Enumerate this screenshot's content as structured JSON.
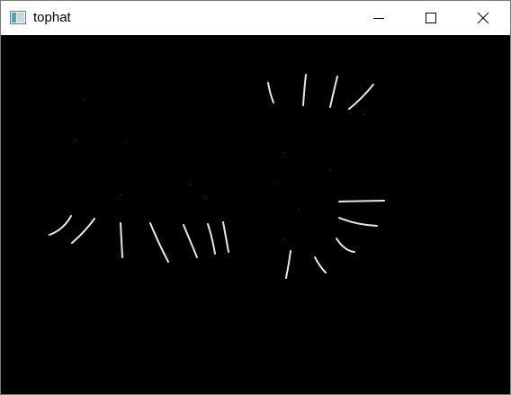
{
  "window": {
    "title": "tophat"
  },
  "icons": {
    "app": "opencv-window-icon",
    "minimize": "minimize-icon",
    "maximize": "maximize-icon",
    "close": "close-icon"
  },
  "colors": {
    "titlebar_bg": "#ffffff",
    "canvas_bg": "#000000",
    "stroke": "#e6e6e6"
  }
}
